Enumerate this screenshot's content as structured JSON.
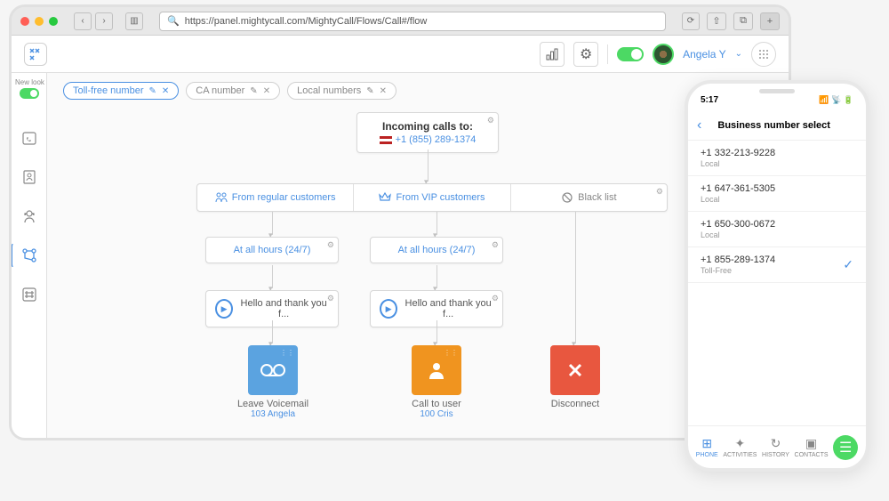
{
  "browser": {
    "url": "https://panel.mightycall.com/MightyCall/Flows/Call#/flow"
  },
  "header": {
    "username": "Angela Y"
  },
  "newlook": "New look",
  "tabs": [
    {
      "label": "Toll-free number",
      "active": true
    },
    {
      "label": "CA number",
      "active": false
    },
    {
      "label": "Local numbers",
      "active": false
    }
  ],
  "flow": {
    "incoming": {
      "title": "Incoming calls to:",
      "number": "+1 (855) 289-1374"
    },
    "sources": {
      "regular": "From regular customers",
      "vip": "From VIP customers",
      "black": "Black list"
    },
    "hours": "At all hours (24/7)",
    "greeting": "Hello and thank you f...",
    "ends": {
      "voicemail": {
        "label": "Leave Voicemail",
        "sub": "103 Angela"
      },
      "calluser": {
        "label": "Call to user",
        "sub": "100 Cris"
      },
      "disconnect": {
        "label": "Disconnect"
      }
    }
  },
  "phone": {
    "time": "5:17",
    "title": "Business number select",
    "items": [
      {
        "num": "+1 332-213-9228",
        "type": "Local",
        "selected": false
      },
      {
        "num": "+1 647-361-5305",
        "type": "Local",
        "selected": false
      },
      {
        "num": "+1 650-300-0672",
        "type": "Local",
        "selected": false
      },
      {
        "num": "+1 855-289-1374",
        "type": "Toll-Free",
        "selected": true
      }
    ],
    "tabbar": {
      "phone": "PHONE",
      "activities": "ACTIVITIES",
      "history": "HISTORY",
      "contacts": "CONTACTS"
    }
  }
}
